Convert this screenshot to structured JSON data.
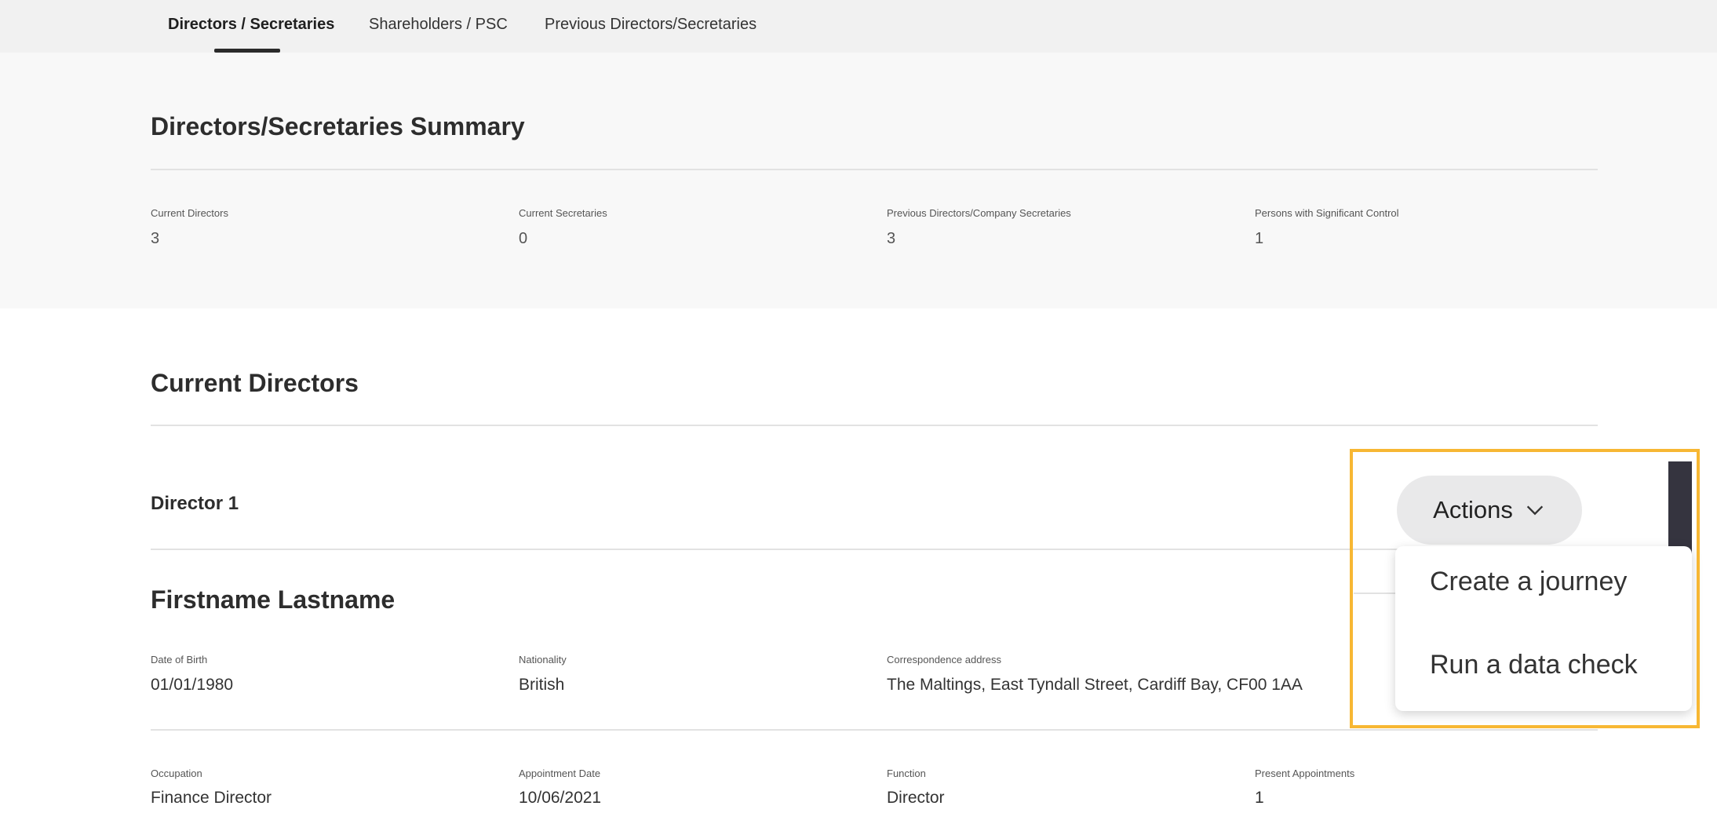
{
  "tabs": [
    {
      "label": "Directors / Secretaries",
      "active": true
    },
    {
      "label": "Shareholders / PSC",
      "active": false
    },
    {
      "label": "Previous Directors/Secretaries",
      "active": false
    }
  ],
  "summary": {
    "title": "Directors/Secretaries Summary",
    "stats": [
      {
        "label": "Current Directors",
        "value": "3"
      },
      {
        "label": "Current Secretaries",
        "value": "0"
      },
      {
        "label": "Previous Directors/Company Secretaries",
        "value": "3"
      },
      {
        "label": "Persons with Significant Control",
        "value": "1"
      }
    ]
  },
  "current_directors": {
    "title": "Current Directors",
    "director": {
      "heading": "Director 1",
      "name": "Firstname Lastname",
      "fields_row1": [
        {
          "label": "Date of Birth",
          "value": "01/01/1980"
        },
        {
          "label": "Nationality",
          "value": "British"
        },
        {
          "label": "Correspondence address",
          "value": "The Maltings, East Tyndall Street, Cardiff Bay, CF00 1AA"
        }
      ],
      "fields_row2": [
        {
          "label": "Occupation",
          "value": "Finance Director"
        },
        {
          "label": "Appointment Date",
          "value": "10/06/2021"
        },
        {
          "label": "Function",
          "value": "Director"
        },
        {
          "label": "Present Appointments",
          "value": "1"
        }
      ]
    }
  },
  "actions": {
    "button_label": "Actions",
    "menu": [
      "Create a journey",
      "Run a data check"
    ]
  },
  "colors": {
    "highlight": "#f7b733",
    "tab_bar": "#f1f1f1",
    "summary_bg": "#f8f8f8"
  }
}
